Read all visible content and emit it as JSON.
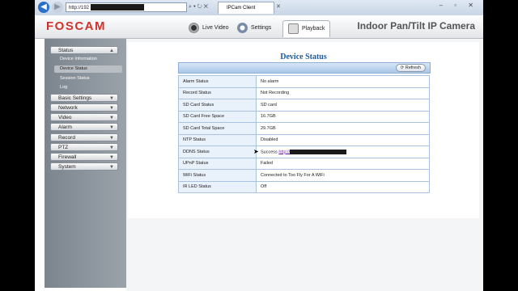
{
  "browser": {
    "address_text": "http://192",
    "address_controls": "⌕ ▾ ↻ ✕",
    "tab_title": "IPCam Client",
    "window_controls": "– ▫ ✕"
  },
  "header": {
    "logo": "FOSCAM",
    "tabs": [
      {
        "label": "Live Video"
      },
      {
        "label": "Settings"
      },
      {
        "label": "Playback"
      }
    ],
    "product": "Indoor Pan/Tilt IP Camera"
  },
  "sidebar": {
    "sections": [
      {
        "label": "Status"
      },
      {
        "label": "Basic Settings"
      },
      {
        "label": "Network"
      },
      {
        "label": "Video"
      },
      {
        "label": "Alarm"
      },
      {
        "label": "Record"
      },
      {
        "label": "PTZ"
      },
      {
        "label": "Firewall"
      },
      {
        "label": "System"
      }
    ],
    "status_items": [
      {
        "label": "Device Information"
      },
      {
        "label": "Device Status"
      },
      {
        "label": "Session Status"
      },
      {
        "label": "Log"
      }
    ]
  },
  "main": {
    "title": "Device Status",
    "refresh": "Refresh",
    "rows": [
      {
        "key": "Alarm Status",
        "value": "No alarm"
      },
      {
        "key": "Record Status",
        "value": "Not Recording"
      },
      {
        "key": "SD Card Status",
        "value": "SD card"
      },
      {
        "key": "SD Card Free Space",
        "value": "16.7GB"
      },
      {
        "key": "SD Card Total Space",
        "value": "29.7GB"
      },
      {
        "key": "NTP Status",
        "value": "Disabled"
      },
      {
        "key": "DDNS Status",
        "value": "Success",
        "link": "http://"
      },
      {
        "key": "UPnP Status",
        "value": "Failed"
      },
      {
        "key": "WiFi Status",
        "value": "Connected to Too Fly For A WiFi"
      },
      {
        "key": "IR LED Status",
        "value": "Off"
      }
    ]
  }
}
